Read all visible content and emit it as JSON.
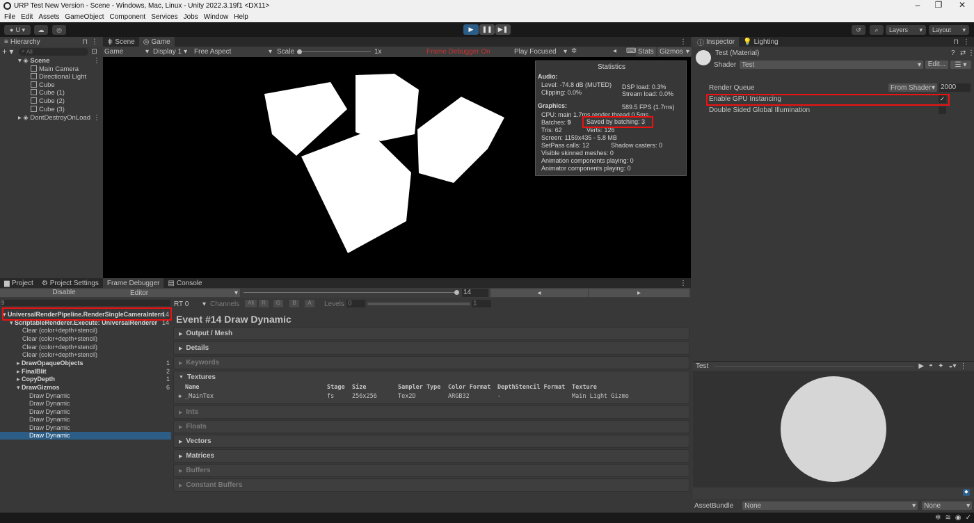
{
  "window": {
    "title": "URP Test New Version - Scene - Windows, Mac, Linux - Unity 2022.3.19f1 <DX11>",
    "minimize": "–",
    "maximize": "❐",
    "close": "✕"
  },
  "menu": [
    "File",
    "Edit",
    "Assets",
    "GameObject",
    "Component",
    "Services",
    "Jobs",
    "Window",
    "Help"
  ],
  "toolbar": {
    "account": "U ▾",
    "layers": "Layers",
    "layout": "Layout"
  },
  "hierarchy": {
    "tab": "Hierarchy",
    "search_placeholder": "All",
    "scene": "Scene",
    "objects": [
      "Main Camera",
      "Directional Light",
      "Cube",
      "Cube (1)",
      "Cube (2)",
      "Cube (3)"
    ],
    "dont_destroy": "DontDestroyOnLoad"
  },
  "game": {
    "tab_scene": "Scene",
    "tab_game": "Game",
    "mode": "Game",
    "display": "Display 1",
    "aspect": "Free Aspect",
    "scale_label": "Scale",
    "scale_value": "1x",
    "frame_debugger": "Frame Debugger On",
    "play_focused": "Play Focused",
    "stats_btn": "Stats",
    "gizmos_btn": "Gizmos"
  },
  "stats": {
    "title": "Statistics",
    "audio": "Audio:",
    "level": "Level: -74.8 dB (MUTED)",
    "clipping": "Clipping: 0.0%",
    "dsp": "DSP load: 0.3%",
    "stream": "Stream load: 0.0%",
    "graphics": "Graphics:",
    "fps": "589.5 FPS (1.7ms)",
    "cpu": "CPU: main 1.7ms  render thread 0.5ms",
    "batches_label": "Batches:",
    "batches_value": "9",
    "saved": "Saved by batching: 3",
    "tris": "Tris: 62",
    "verts": "Verts: 126",
    "screen": "Screen: 1159x435 - 5.8 MB",
    "setpass": "SetPass calls: 12",
    "shadow": "Shadow casters: 0",
    "skinned": "Visible skinned meshes: 0",
    "anim_comp": "Animation components playing: 0",
    "animator_comp": "Animator components playing: 0"
  },
  "inspector": {
    "tab": "Inspector",
    "lighting_tab": "Lighting",
    "material_name": "Test (Material)",
    "shader_label": "Shader",
    "shader_value": "Test",
    "edit_btn": "Edit...",
    "render_queue": "Render Queue",
    "render_queue_mode": "From Shader",
    "render_queue_value": "2000",
    "gpu_instancing": "Enable GPU Instancing",
    "gpu_instancing_checked": "✓",
    "double_sided": "Double Sided Global Illumination",
    "preview_title": "Test",
    "asset_bundle": "AssetBundle",
    "asset_bundle_value": "None",
    "variant_value": "None"
  },
  "bottom": {
    "tabs": [
      "Project",
      "Project Settings",
      "Frame Debugger",
      "Console"
    ],
    "disable": "Disable",
    "editor": "Editor",
    "event_number": "14",
    "search_value": "9",
    "rt": "RT 0",
    "channels": "Channels",
    "channel_buttons": [
      "All",
      "R",
      "G",
      "B",
      "A"
    ],
    "levels": "Levels",
    "levels_min": "0",
    "levels_max": "1",
    "event_title": "Event #14 Draw Dynamic",
    "sections": [
      "Output / Mesh",
      "Details",
      "Keywords",
      "Textures",
      "Ints",
      "Floats",
      "Vectors",
      "Matrices",
      "Buffers",
      "Constant Buffers"
    ],
    "texture_headers": [
      "Name",
      "Stage",
      "Size",
      "Sampler Type",
      "Color Format",
      "DepthStencil Format",
      "Texture"
    ],
    "texture_row": [
      "_MainTex",
      "fs",
      "256x256",
      "Tex2D",
      "ARGB32",
      "-",
      "Main Light Gizmo"
    ]
  },
  "frame_tree": [
    {
      "label": "UniversalRenderPipeline.RenderSingleCameraIntern",
      "count": "14",
      "bold": true
    },
    {
      "label": "ScriptableRenderer.Execute: UniversalRenderer",
      "count": "14",
      "bold": true
    },
    {
      "label": "Clear (color+depth+stencil)",
      "count": ""
    },
    {
      "label": "Clear (color+depth+stencil)",
      "count": ""
    },
    {
      "label": "Clear (color+depth+stencil)",
      "count": ""
    },
    {
      "label": "Clear (color+depth+stencil)",
      "count": ""
    },
    {
      "label": "DrawOpaqueObjects",
      "count": "1",
      "bold": true
    },
    {
      "label": "FinalBlit",
      "count": "2",
      "bold": true
    },
    {
      "label": "CopyDepth",
      "count": "1",
      "bold": true
    },
    {
      "label": "DrawGizmos",
      "count": "6",
      "bold": true
    },
    {
      "label": "Draw Dynamic",
      "count": ""
    },
    {
      "label": "Draw Dynamic",
      "count": ""
    },
    {
      "label": "Draw Dynamic",
      "count": ""
    },
    {
      "label": "Draw Dynamic",
      "count": ""
    },
    {
      "label": "Draw Dynamic",
      "count": ""
    },
    {
      "label": "Draw Dynamic",
      "count": ""
    }
  ]
}
